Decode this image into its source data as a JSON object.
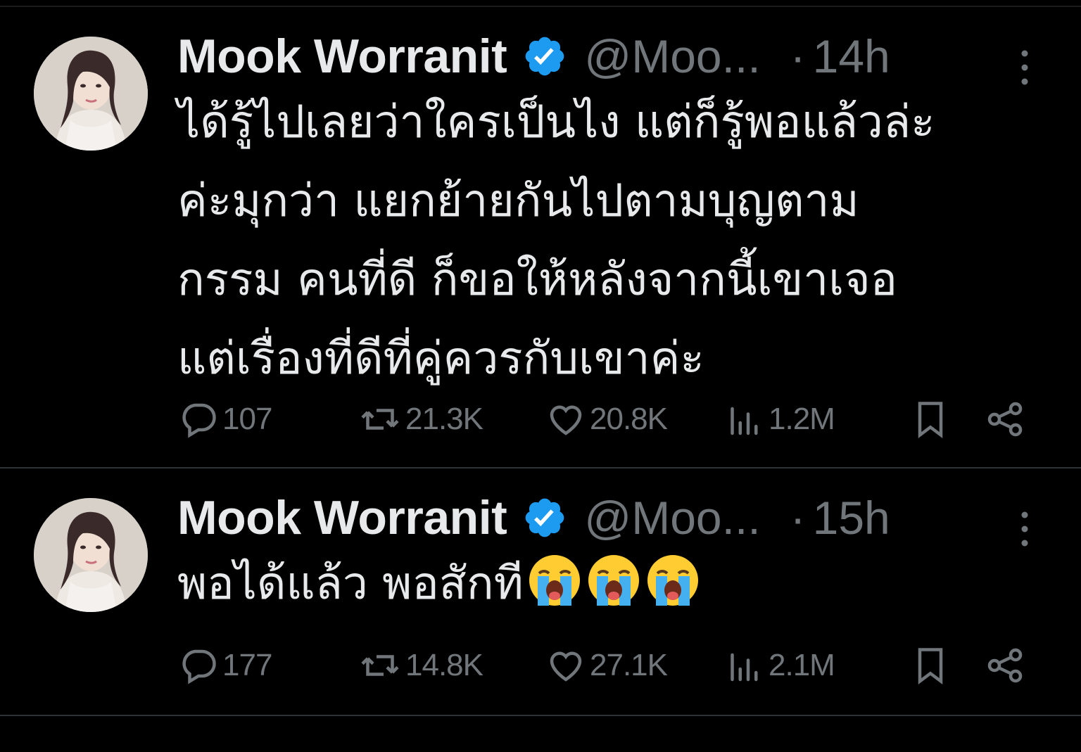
{
  "tweets": [
    {
      "display_name": "Mook Worranit",
      "handle": "@Moo...",
      "separator": "·",
      "time": "14h",
      "text": "ได้รู้ไปเลยว่าใครเป็นไง แต่ก็รู้พอแล้วล่ะ\nค่ะมุกว่า แยกย้ายกันไปตามบุญตาม\nกรรม คนที่ดี ก็ขอให้หลังจากนี้เขาเจอ\nแต่เรื่องที่ดีที่คู่ควรกับเขาค่ะ",
      "emoji": [],
      "replies": "107",
      "retweets": "21.3K",
      "likes": "20.8K",
      "views": "1.2M"
    },
    {
      "display_name": "Mook Worranit",
      "handle": "@Moo...",
      "separator": "·",
      "time": "15h",
      "text": "พอได้แล้ว พอสักที",
      "emoji": [
        "loudly-crying-face",
        "loudly-crying-face",
        "loudly-crying-face"
      ],
      "replies": "177",
      "retweets": "14.8K",
      "likes": "27.1K",
      "views": "2.1M"
    }
  ],
  "colors": {
    "background": "#000000",
    "text_primary": "#e7e9ea",
    "text_secondary": "#71767b",
    "divider": "#2f3336",
    "verified_badge": "#1d9bf0"
  },
  "icons": {
    "verified": "verified-badge-icon",
    "more": "more-vertical-icon",
    "reply": "reply-icon",
    "retweet": "retweet-icon",
    "like": "heart-icon",
    "views": "views-icon",
    "bookmark": "bookmark-icon",
    "share": "share-icon"
  }
}
